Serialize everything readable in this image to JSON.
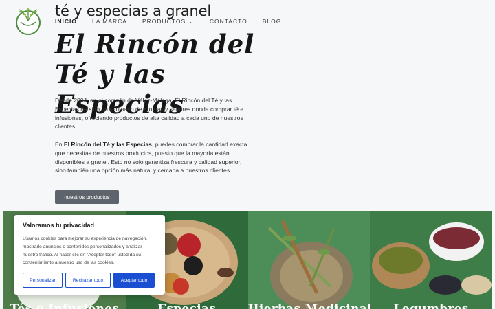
{
  "header": {
    "logo_icon": "tea-leaf-logo-icon",
    "site_title": "té y especias a granel"
  },
  "nav": {
    "items": [
      {
        "label": "INICIO",
        "active": true
      },
      {
        "label": "LA MARCA"
      },
      {
        "label": "PRODUCTOS",
        "has_dropdown": true
      },
      {
        "label": "CONTACTO"
      },
      {
        "label": "BLOG"
      }
    ],
    "dropdown_icon": "chevron-down-icon"
  },
  "hero": {
    "title_line1": "El Rincón del",
    "title_line2": "Té y las Especias",
    "p1": "Desde 2004, en el corazón de Vélez-Málaga, El Rincón del Té y las Especias ha sido un santuario de aromas y sabores donde comprar té e infusiones, ofreciendo productos de alta calidad a cada uno de nuestros clientes.",
    "p2_prefix": "En ",
    "p2_bold": "El Rincón del Té y las Especias",
    "p2_suffix": ", puedes comprar la cantidad exacta que necesitas de nuestros productos, puesto que la mayoría están disponibles a granel. Esto no solo garantiza frescura y calidad superior, sino también una opción más natural y cercana a nuestros clientes.",
    "cta_label": "nuestros productos"
  },
  "tiles": [
    {
      "label": "Tés e Infusiones",
      "bg": "#4f7d4a"
    },
    {
      "label": "Especias",
      "bg": "#2f6a3a"
    },
    {
      "label": "Hierbas Medicinales",
      "bg": "#4d8e58"
    },
    {
      "label": "Legumbres",
      "bg": "#3f7d48"
    }
  ],
  "cookie": {
    "title": "Valoramos tu privacidad",
    "text": "Usamos cookies para mejorar su experiencia de navegación, mostrarle anuncios o contenidos personalizados y analizar nuestro tráfico. Al hacer clic en \"Aceptar todo\" usted da su consentimiento a nuestro uso de las cookies.",
    "customize_label": "Personalizar",
    "reject_label": "Rechazar todo",
    "accept_label": "Aceptar todo"
  },
  "colors": {
    "accent": "#1a4fd1",
    "button_gray": "#5e646c",
    "background": "#f6f7f8"
  }
}
